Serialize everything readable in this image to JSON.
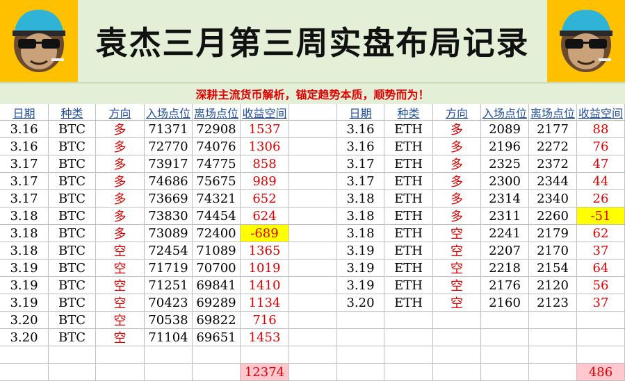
{
  "title": "袁杰三月第三周实盘布局记录",
  "subtitle": "深耕主流货币解析，锚定趋势本质，顺势而为！",
  "headers": [
    "日期",
    "种类",
    "方向",
    "入场点位",
    "离场点位",
    "收益空间"
  ],
  "btc_rows": [
    [
      "3.16",
      "BTC",
      "多",
      "71371",
      "72908",
      "1537"
    ],
    [
      "3.16",
      "BTC",
      "多",
      "72770",
      "74076",
      "1306"
    ],
    [
      "3.17",
      "BTC",
      "多",
      "73917",
      "74775",
      "858"
    ],
    [
      "3.17",
      "BTC",
      "多",
      "74686",
      "75675",
      "989"
    ],
    [
      "3.17",
      "BTC",
      "多",
      "73669",
      "74321",
      "652"
    ],
    [
      "3.18",
      "BTC",
      "多",
      "73830",
      "74454",
      "624"
    ],
    [
      "3.18",
      "BTC",
      "多",
      "73089",
      "72400",
      "-689"
    ],
    [
      "3.18",
      "BTC",
      "空",
      "72454",
      "71089",
      "1365"
    ],
    [
      "3.19",
      "BTC",
      "空",
      "71719",
      "70700",
      "1019"
    ],
    [
      "3.19",
      "BTC",
      "空",
      "71251",
      "69841",
      "1410"
    ],
    [
      "3.19",
      "BTC",
      "空",
      "70423",
      "69289",
      "1134"
    ],
    [
      "3.20",
      "BTC",
      "空",
      "70538",
      "69822",
      "716"
    ],
    [
      "3.20",
      "BTC",
      "空",
      "71104",
      "69651",
      "1453"
    ]
  ],
  "eth_rows": [
    [
      "3.16",
      "ETH",
      "多",
      "2089",
      "2177",
      "88"
    ],
    [
      "3.16",
      "ETH",
      "多",
      "2196",
      "2272",
      "76"
    ],
    [
      "3.17",
      "ETH",
      "多",
      "2325",
      "2372",
      "47"
    ],
    [
      "3.17",
      "ETH",
      "多",
      "2300",
      "2344",
      "44"
    ],
    [
      "3.18",
      "ETH",
      "多",
      "2314",
      "2340",
      "26"
    ],
    [
      "3.18",
      "ETH",
      "多",
      "2311",
      "2260",
      "-51"
    ],
    [
      "3.18",
      "ETH",
      "空",
      "2241",
      "2179",
      "62"
    ],
    [
      "3.19",
      "ETH",
      "空",
      "2207",
      "2170",
      "37"
    ],
    [
      "3.19",
      "ETH",
      "空",
      "2218",
      "2154",
      "64"
    ],
    [
      "3.19",
      "ETH",
      "空",
      "2176",
      "2120",
      "56"
    ],
    [
      "3.20",
      "ETH",
      "空",
      "2160",
      "2123",
      "37"
    ]
  ],
  "btc_total": "12374",
  "eth_total": "486",
  "colors": {
    "header_bg": "#e3efd6",
    "logo_bg": "#ffc000",
    "profit": "#e00000",
    "loss_highlight": "#ffff00",
    "total_bg": "#ffc7ce",
    "col_header": "#1f4e9c"
  },
  "icons": {
    "logo": "monkey-with-sunglasses-icon"
  }
}
